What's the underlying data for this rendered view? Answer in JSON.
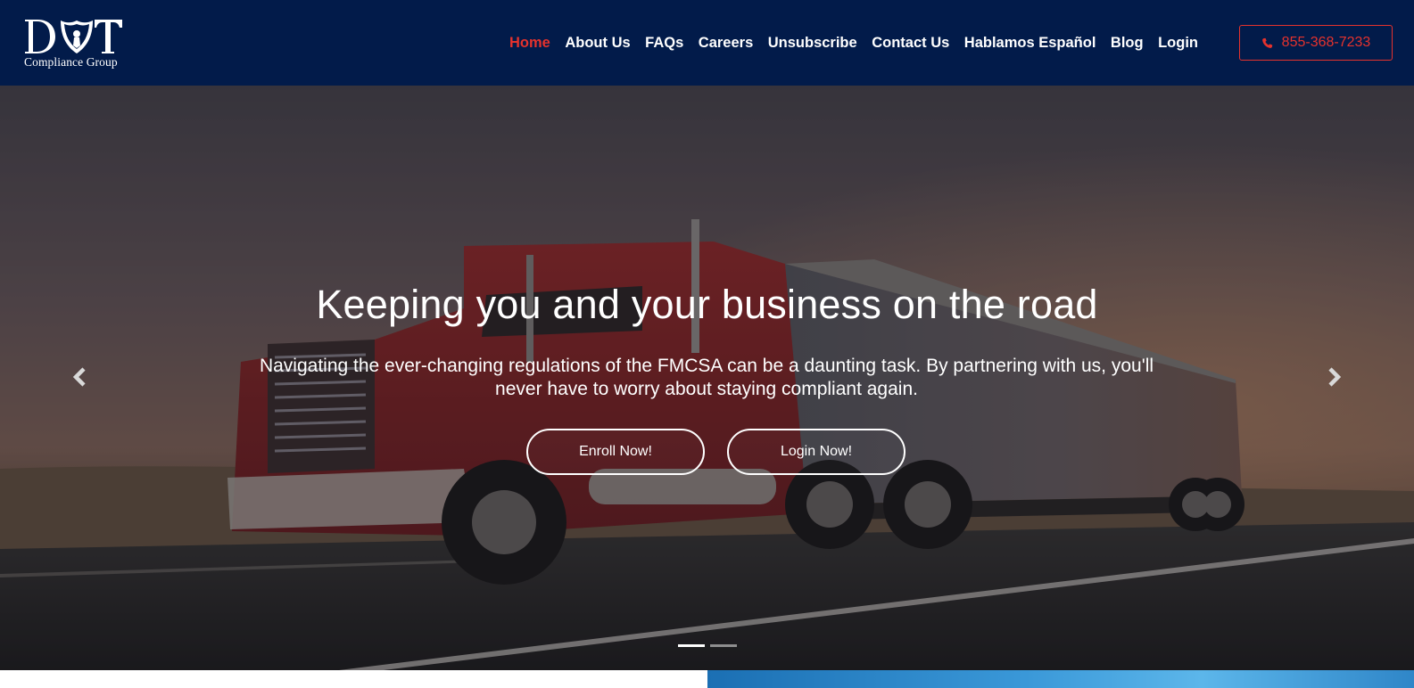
{
  "header": {
    "logo": {
      "mark_text": "DOT",
      "subtitle": "Compliance Group"
    },
    "nav": [
      {
        "label": "Home",
        "active": true
      },
      {
        "label": "About Us",
        "active": false
      },
      {
        "label": "FAQs",
        "active": false
      },
      {
        "label": "Careers",
        "active": false
      },
      {
        "label": "Unsubscribe",
        "active": false
      },
      {
        "label": "Contact Us",
        "active": false
      },
      {
        "label": "Hablamos Español",
        "active": false
      },
      {
        "label": "Blog",
        "active": false
      },
      {
        "label": "Login",
        "active": false
      }
    ],
    "phone": {
      "icon": "phone-icon",
      "number": "855-368-7233"
    }
  },
  "hero": {
    "title": "Keeping you and your business on the road",
    "text": "Navigating the ever-changing regulations of the FMCSA can be a daunting task. By partnering with us, you'll never have to worry about staying compliant again.",
    "buttons": {
      "enroll": "Enroll Now!",
      "login": "Login Now!"
    },
    "prev_icon": "chevron-left-icon",
    "next_icon": "chevron-right-icon",
    "slide_count": 2,
    "active_slide": 1
  },
  "colors": {
    "header_bg": "#021b4a",
    "accent_red": "#e5322d",
    "text_white": "#ffffff"
  }
}
